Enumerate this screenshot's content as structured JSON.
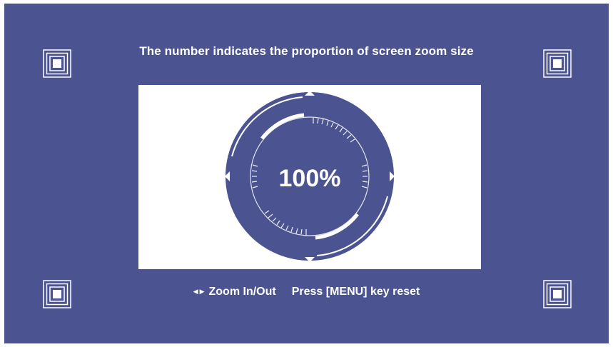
{
  "screen": {
    "background_color": "#4b5391",
    "title": "The number indicates the proportion of screen zoom size"
  },
  "preview": {
    "background_color": "#ffffff",
    "zoom_value": "100%",
    "dial_color": "#4b5391"
  },
  "footer": {
    "arrows_icon": "left-right-arrows-icon",
    "zoom_label": "Zoom In/Out",
    "reset_hint": "Press [MENU] key reset"
  },
  "corner_markers": [
    "top-left",
    "top-right",
    "bottom-left",
    "bottom-right"
  ]
}
